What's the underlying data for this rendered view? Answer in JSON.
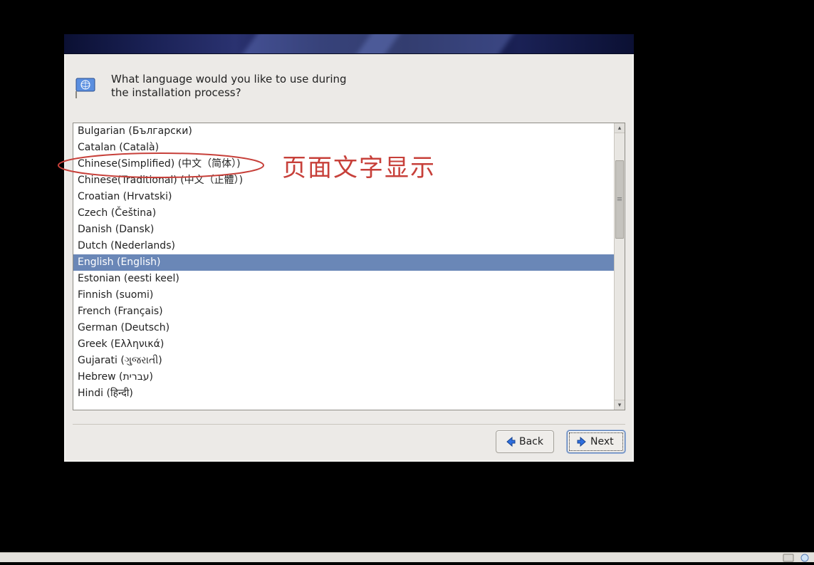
{
  "prompt": "What language would you like to use during the installation process?",
  "languages": [
    {
      "label": "Bulgarian (Български)",
      "selected": false
    },
    {
      "label": "Catalan (Català)",
      "selected": false
    },
    {
      "label": "Chinese(Simplified) (中文（简体）)",
      "selected": false
    },
    {
      "label": "Chinese(Traditional) (中文（正體）)",
      "selected": false
    },
    {
      "label": "Croatian (Hrvatski)",
      "selected": false
    },
    {
      "label": "Czech (Čeština)",
      "selected": false
    },
    {
      "label": "Danish (Dansk)",
      "selected": false
    },
    {
      "label": "Dutch (Nederlands)",
      "selected": false
    },
    {
      "label": "English (English)",
      "selected": true
    },
    {
      "label": "Estonian (eesti keel)",
      "selected": false
    },
    {
      "label": "Finnish (suomi)",
      "selected": false
    },
    {
      "label": "French (Français)",
      "selected": false
    },
    {
      "label": "German (Deutsch)",
      "selected": false
    },
    {
      "label": "Greek (Ελληνικά)",
      "selected": false
    },
    {
      "label": "Gujarati (ગુજરાતી)",
      "selected": false
    },
    {
      "label": "Hebrew (עברית)",
      "selected": false
    },
    {
      "label": "Hindi (हिन्दी)",
      "selected": false
    }
  ],
  "buttons": {
    "back": "Back",
    "next": "Next"
  },
  "annotation_text": "页面文字显示"
}
